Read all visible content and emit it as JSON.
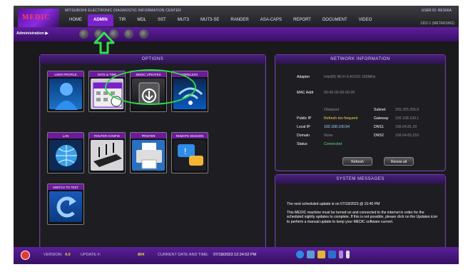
{
  "app": {
    "logo_text": "MEDIC",
    "title": "MITSUBISHI ELECTRONIC DIAGNOSTIC INFORMATION CENTER",
    "user_id": "USER ID: RES66A"
  },
  "menu": [
    "HOME",
    "ADMIN",
    "TIR",
    "MDL",
    "SST",
    "MUT3",
    "MUT3-SE",
    "RANDER",
    "ASA-CAPS",
    "REPORT",
    "DOCUMENT",
    "VIDEO"
  ],
  "menu_active": "ADMIN",
  "subbar": {
    "breadcrumb": "Administration ▶",
    "right_text": "1352-1 (METARSNG)"
  },
  "options": {
    "title": "OPTIONS",
    "tiles": [
      {
        "label": "USER PROFILE",
        "icon": "user-profile-icon"
      },
      {
        "label": "DATE & TIME",
        "icon": "calendar-icon"
      },
      {
        "label": "MEDIC UPDATES",
        "icon": "download-icon"
      },
      {
        "label": "WIRELESS",
        "icon": "wifi-icon"
      },
      {
        "label": "LAN",
        "icon": "globe-icon"
      },
      {
        "label": "ROUTER CONFIG",
        "icon": "router-icon"
      },
      {
        "label": "PRINTER",
        "icon": "printer-icon"
      },
      {
        "label": "REMOTE SESSION",
        "icon": "chat-icon"
      },
      {
        "label": "SWITCH TO TEST",
        "icon": "switch-icon"
      }
    ]
  },
  "network": {
    "title": "NETWORK INFORMATION",
    "adapter_label": "Adapter",
    "adapter_value": "Intel(R) Wi-Fi 6 AX201 160MHz",
    "mac_label": "MAC Addr",
    "mac_value": "00-00-00-00-00-00",
    "rows": [
      {
        "label": "",
        "value": "Obtained",
        "right_label": "Subnet",
        "right_value": "255.255.255.0"
      },
      {
        "label": "Public IP",
        "value": "Refresh too frequent",
        "right_label": "Gateway",
        "right_value": "192.168.100.1"
      },
      {
        "label": "Local IP",
        "value": "192.168.100.54",
        "right_label": "DNS1",
        "right_value": "156.64.81.20"
      },
      {
        "label": "Domain",
        "value": "None",
        "right_label": "DNS2",
        "right_value": "156.64.65.210"
      },
      {
        "label": "Status",
        "value": "Connected",
        "right_label": "",
        "right_value": ""
      }
    ],
    "refresh_label": "Refresh",
    "renew_label": "Renew all"
  },
  "system_messages": {
    "title": "SYSTEM MESSAGES",
    "line1": "The next scheduled update is on 07/18/2023 @ 10:45 PM",
    "line2": "This MEDIC machine must be turned on and connected to the internet in order for the scheduled nightly updates to complete. If this is not possible, please click on the Updates icon to perform a manual update to keep your MEDIC software current."
  },
  "footer": {
    "version_label": "VERSION:",
    "version_value": "4.0",
    "update_label": "UPDATE #:",
    "update_value": "804",
    "datetime_label": "CURRENT DATE AND TIME:",
    "datetime_value": "07/18/2023 12:24:52 PM"
  },
  "colors": {
    "accent": "#7a22c9",
    "highlight_ring": "#2fd84a",
    "arrow": "#33e04d"
  }
}
